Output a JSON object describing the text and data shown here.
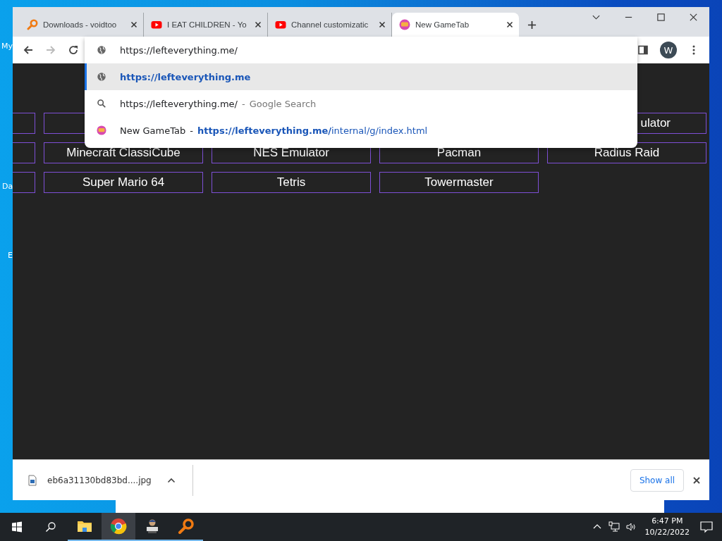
{
  "desktop_icons": [
    {
      "label": "My"
    },
    {
      "label": "Da"
    },
    {
      "label": "E"
    }
  ],
  "tabs": [
    {
      "title": "Downloads - voidtoo",
      "kind": "magnifier",
      "selected": false
    },
    {
      "title": "I EAT CHILDREN - Yo",
      "kind": "video",
      "selected": false
    },
    {
      "title": "Channel customizatic",
      "kind": "video",
      "selected": false
    },
    {
      "title": "New GameTab",
      "kind": "game",
      "selected": true
    }
  ],
  "address": {
    "value": "https://lefteverything.me/"
  },
  "avatar": "W",
  "suggestions": [
    {
      "kind": "url",
      "text": "https://lefteverything.me",
      "selected": true
    },
    {
      "kind": "search",
      "text": "https://lefteverything.me/",
      "separator": "-",
      "suffix": "Google Search",
      "selected": false
    },
    {
      "kind": "history",
      "text": "New GameTab",
      "separator": "-",
      "url": "**https://lefteverything.me/**internal/g/index.html",
      "selected": false
    }
  ],
  "games": [
    {
      "tiles": [
        {
          "kind": "blank"
        },
        {
          "kind": "blank"
        },
        {
          "kind": "game",
          "label": "ulator"
        }
      ]
    },
    {
      "tiles": [
        {
          "kind": "blank"
        },
        {
          "kind": "game",
          "label": "Minecraft ClassiCube"
        },
        {
          "kind": "game",
          "label": "NES Emulator"
        },
        {
          "kind": "game",
          "label": "Pacman"
        },
        {
          "kind": "game",
          "label": "Radius Raid"
        }
      ]
    },
    {
      "tiles": [
        {
          "kind": "blank"
        },
        {
          "kind": "game",
          "label": "Super Mario 64"
        },
        {
          "kind": "game",
          "label": "Tetris"
        },
        {
          "kind": "game",
          "label": "Towermaster"
        }
      ]
    }
  ],
  "download": {
    "file": "eb6a31130bd83bd....jpg",
    "show_all": "Show all"
  },
  "taskbar": {
    "apps": [
      {
        "kind": "explorer",
        "running": true,
        "selected": false
      },
      {
        "kind": "chrome",
        "running": true,
        "selected": true
      },
      {
        "kind": "app",
        "running": true,
        "selected": false
      },
      {
        "kind": "magnifier",
        "running": true,
        "selected": false
      }
    ],
    "time": "6:47 PM",
    "date": "10/22/2022"
  }
}
